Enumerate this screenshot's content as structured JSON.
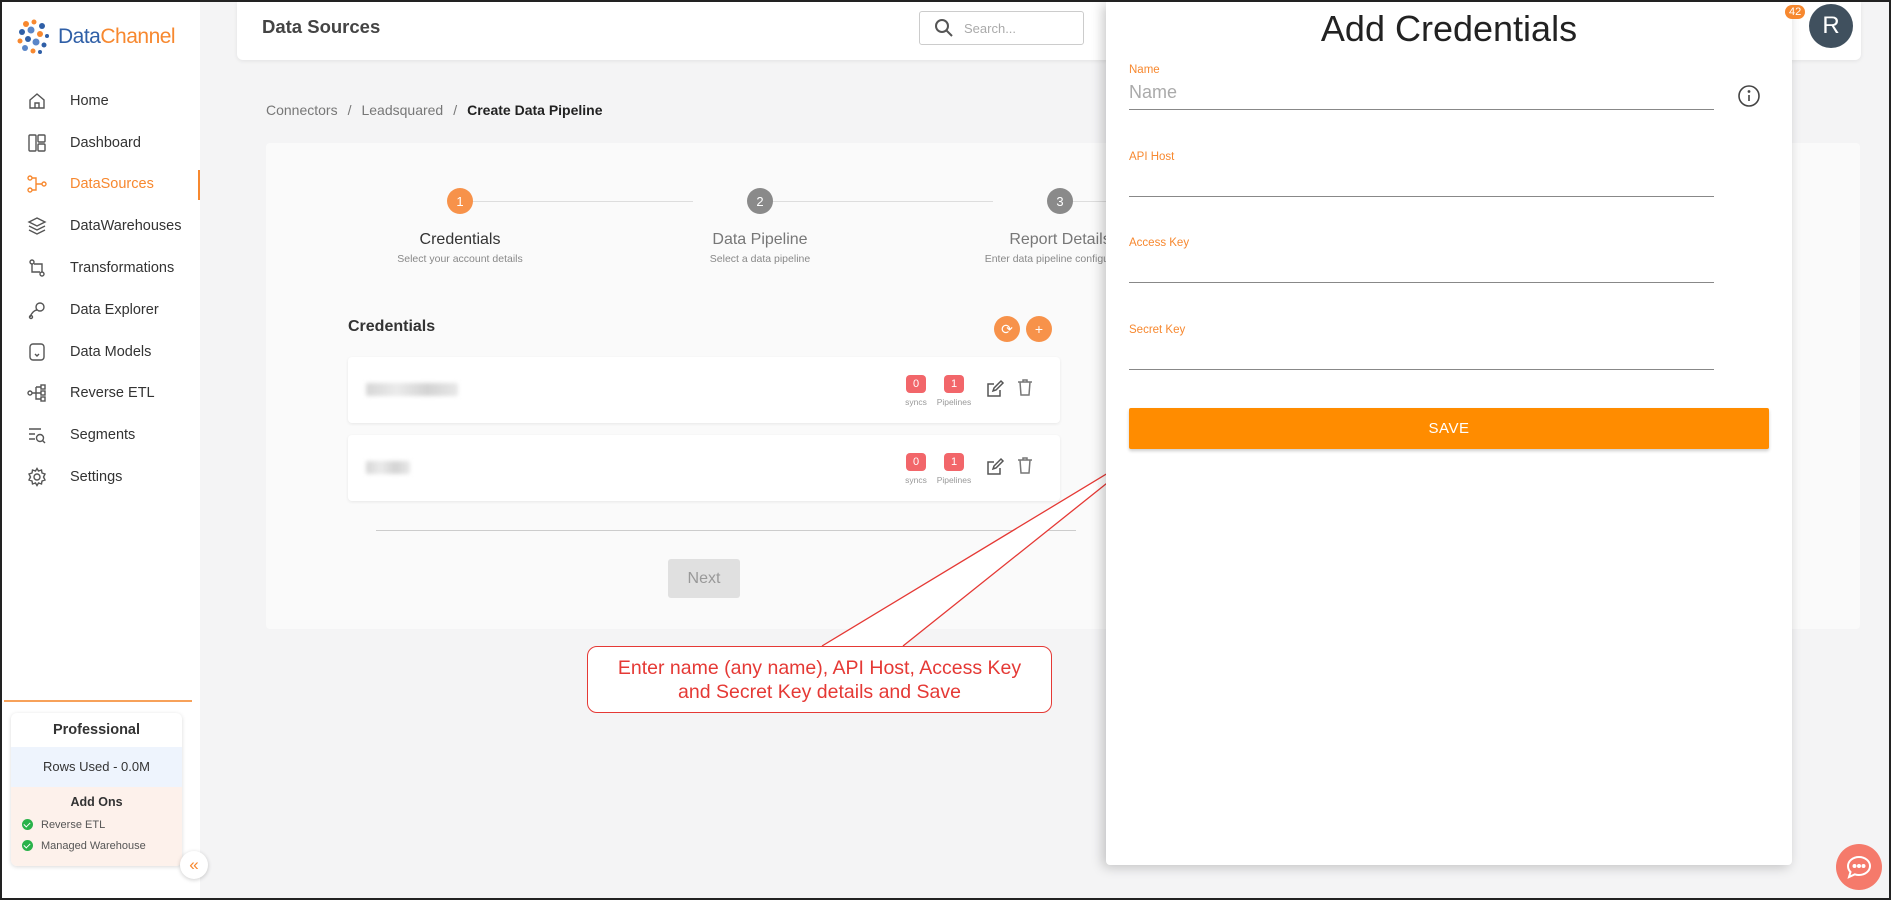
{
  "brand": {
    "name_part1": "Data",
    "name_part2": "Channel"
  },
  "sidebar": {
    "items": [
      {
        "label": "Home",
        "icon": "home-icon"
      },
      {
        "label": "Dashboard",
        "icon": "dashboard-icon"
      },
      {
        "label": "DataSources",
        "icon": "datasources-icon",
        "active": true
      },
      {
        "label": "DataWarehouses",
        "icon": "layers-icon"
      },
      {
        "label": "Transformations",
        "icon": "transform-icon"
      },
      {
        "label": "Data Explorer",
        "icon": "explorer-icon"
      },
      {
        "label": "Data Models",
        "icon": "models-icon"
      },
      {
        "label": "Reverse ETL",
        "icon": "reverse-etl-icon"
      },
      {
        "label": "Segments",
        "icon": "segments-icon"
      },
      {
        "label": "Settings",
        "icon": "gear-icon"
      }
    ],
    "plan": {
      "title": "Professional",
      "rows_used": "Rows Used - 0.0M",
      "addons_title": "Add Ons",
      "addons": [
        "Reverse ETL",
        "Managed Warehouse"
      ]
    }
  },
  "header": {
    "title": "Data Sources",
    "search_placeholder": "Search...",
    "notification_count": "42",
    "avatar_initial": "R"
  },
  "breadcrumb": [
    "Connectors",
    "/",
    "Leadsquared",
    "/",
    "Create Data Pipeline"
  ],
  "stepper": [
    {
      "num": "1",
      "label": "Credentials",
      "sub": "Select your account details",
      "active": true
    },
    {
      "num": "2",
      "label": "Data Pipeline",
      "sub": "Select a data pipeline"
    },
    {
      "num": "3",
      "label": "Report Details",
      "sub": "Enter data pipeline configuration"
    }
  ],
  "credentials": {
    "heading": "Credentials",
    "refresh_label": "⟳",
    "add_label": "+",
    "rows": [
      {
        "syncs": "0",
        "syncs_label": "syncs",
        "pipelines": "1",
        "pipelines_label": "Pipelines"
      },
      {
        "syncs": "0",
        "syncs_label": "syncs",
        "pipelines": "1",
        "pipelines_label": "Pipelines"
      }
    ],
    "next_label": "Next"
  },
  "drawer": {
    "title": "Add Credentials",
    "fields": [
      {
        "label": "Name",
        "placeholder": "Name",
        "value": ""
      },
      {
        "label": "API Host",
        "placeholder": "",
        "value": ""
      },
      {
        "label": "Access Key",
        "placeholder": "",
        "value": ""
      },
      {
        "label": "Secret Key",
        "placeholder": "",
        "value": ""
      }
    ],
    "save_label": "SAVE"
  },
  "callout": {
    "line1": "Enter name (any name), API Host, Access Key",
    "line2": "and Secret Key details and Save"
  },
  "colors": {
    "accent": "#f7882f",
    "save": "#ff8c00",
    "badge": "#f2666a",
    "callout": "#e53935"
  }
}
